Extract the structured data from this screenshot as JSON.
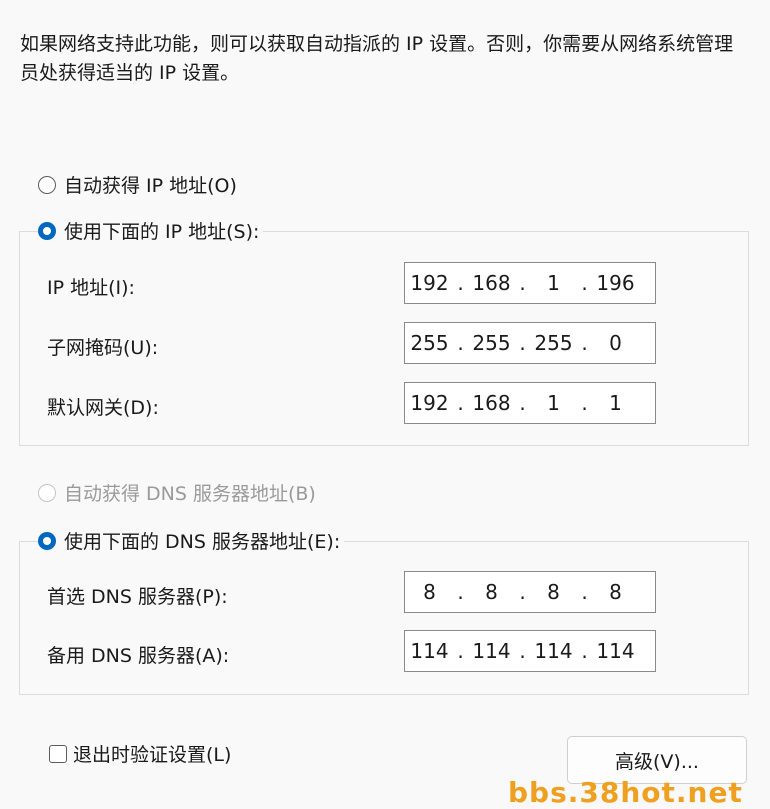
{
  "description": "如果网络支持此功能，则可以获取自动指派的 IP 设置。否则，你需要从网络系统管理员处获得适当的 IP 设置。",
  "ip": {
    "auto_label": "自动获得 IP 地址(O)",
    "manual_label": "使用下面的 IP 地址(S):",
    "auto_selected": false,
    "manual_selected": true,
    "fields": [
      {
        "label": "IP 地址(I):",
        "octets": [
          "192",
          "168",
          "1",
          "196"
        ]
      },
      {
        "label": "子网掩码(U):",
        "octets": [
          "255",
          "255",
          "255",
          "0"
        ]
      },
      {
        "label": "默认网关(D):",
        "octets": [
          "192",
          "168",
          "1",
          "1"
        ]
      }
    ]
  },
  "dns": {
    "auto_label": "自动获得 DNS 服务器地址(B)",
    "manual_label": "使用下面的 DNS 服务器地址(E):",
    "auto_selected": false,
    "auto_disabled": true,
    "manual_selected": true,
    "fields": [
      {
        "label": "首选 DNS 服务器(P):",
        "octets": [
          "8",
          "8",
          "8",
          "8"
        ]
      },
      {
        "label": "备用 DNS 服务器(A):",
        "octets": [
          "114",
          "114",
          "114",
          "114"
        ]
      }
    ]
  },
  "validate_label": "退出时验证设置(L)",
  "validate_checked": false,
  "advanced_button": "高级(V)...",
  "watermark": "bbs.38hot.net",
  "colors": {
    "accent": "#0067c0",
    "watermark": "#f0a020"
  }
}
